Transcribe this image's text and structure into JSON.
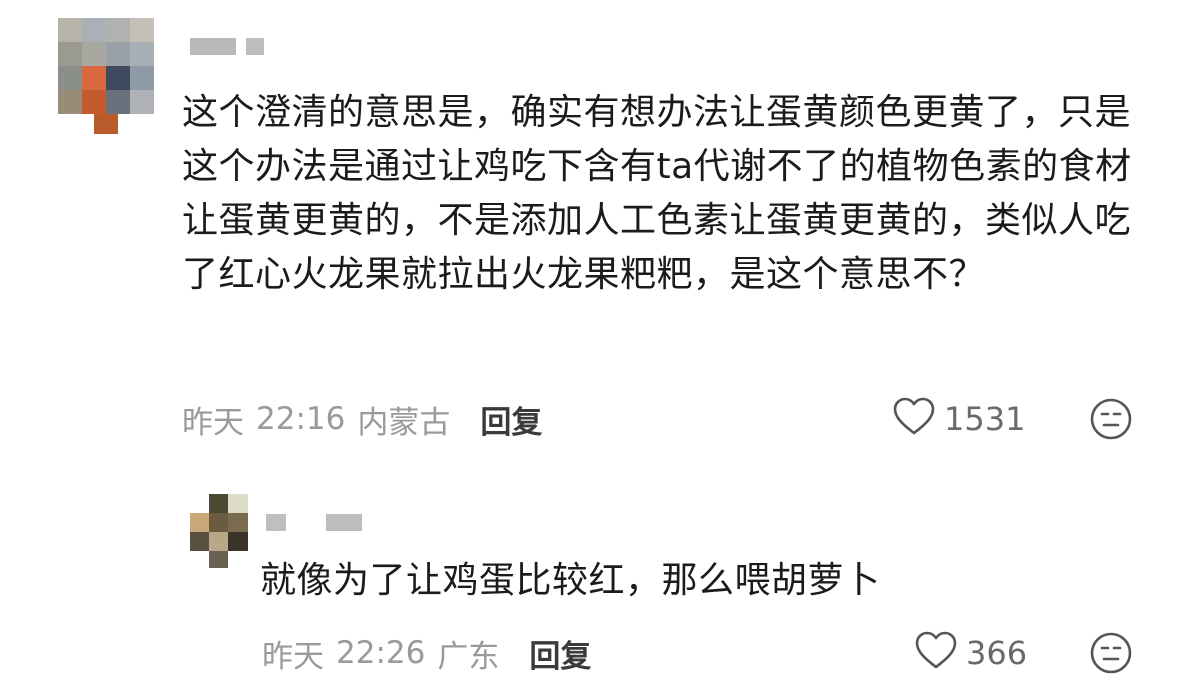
{
  "comments": [
    {
      "text": "这个澄清的意思是，确实有想办法让蛋黄颜色更黄了，只是这个办法是通过让鸡吃下含有ta代谢不了的植物色素的食材让蛋黄更黄的，不是添加人工色素让蛋黄更黄的，类似人吃了红心火龙果就拉出火龙果粑粑，是这个意思不？",
      "date": "昨天",
      "time": "22:16",
      "location": "内蒙古",
      "reply_label": "回复",
      "likes": "1531",
      "avatar_icon": "pixelated-avatar",
      "username_icon": "blurred-username"
    },
    {
      "text": "就像为了让鸡蛋比较红，那么喂胡萝卜",
      "date": "昨天",
      "time": "22:26",
      "location": "广东",
      "reply_label": "回复",
      "likes": "366",
      "avatar_icon": "pixelated-avatar",
      "username_icon": "blurred-username"
    }
  ],
  "icons": {
    "like": "heart-outline-icon",
    "react": "neutral-face-icon"
  },
  "colors": {
    "meta_text": "#9a9a9a",
    "reply_text": "#3a3a3a",
    "body_text": "#1b1b1b",
    "icon_stroke": "#555555"
  }
}
